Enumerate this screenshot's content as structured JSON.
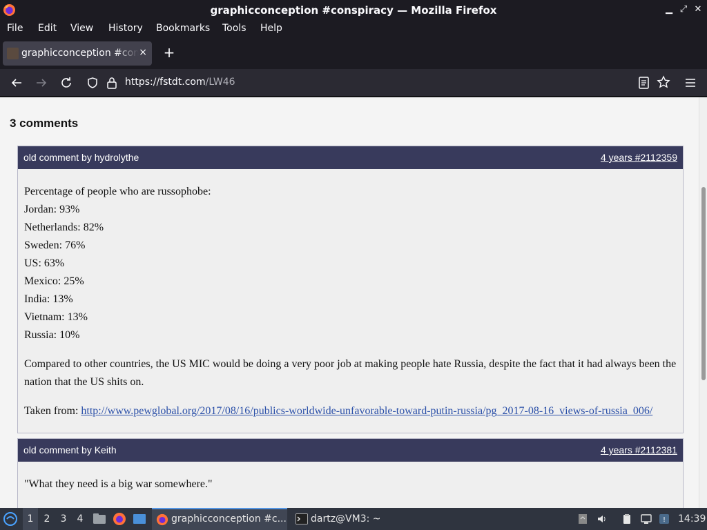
{
  "window": {
    "title": "graphicconception #conspiracy — Mozilla Firefox"
  },
  "menu": {
    "items": [
      "File",
      "Edit",
      "View",
      "History",
      "Bookmarks",
      "Tools",
      "Help"
    ]
  },
  "tabs": [
    {
      "title": "graphicconception #conspiracy",
      "close": "×"
    }
  ],
  "newtab_label": "+",
  "navbar": {
    "url_host": "https://fstdt.com",
    "url_path": "/LW46"
  },
  "page": {
    "comments_count_label": "3 comments",
    "comments": [
      {
        "by": "old comment by hydrolythe",
        "meta": "4 years #2112359",
        "lines": [
          "Percentage of people who are russophobe:",
          "Jordan: 93%",
          "Netherlands: 82%",
          "Sweden: 76%",
          "US: 63%",
          "Mexico: 25%",
          "India: 13%",
          "Vietnam: 13%",
          "Russia: 10%"
        ],
        "paragraph": "Compared to other countries, the US MIC would be doing a very poor job at making people hate Russia, despite the fact that it had always been the nation that the US shits on.",
        "source_prefix": "Taken from: ",
        "source_link": "http://www.pewglobal.org/2017/08/16/publics-worldwide-unfavorable-toward-putin-russia/pg_2017-08-16_views-of-russia_006/"
      },
      {
        "by": "old comment by Keith",
        "meta": "4 years #2112381",
        "lines": [
          "\"What they need is a big war somewhere.\""
        ]
      }
    ]
  },
  "taskbar": {
    "workspaces": [
      "1",
      "2",
      "3",
      "4"
    ],
    "tasks": [
      {
        "label": "graphicconception #c..."
      },
      {
        "label": "dartz@VM3: ~"
      }
    ],
    "clock": "14:39"
  },
  "colors": {
    "comment_header": "#383a5c",
    "link": "#2a4fa8",
    "toolbar": "#2b2a33",
    "taskbar": "#2f343f"
  }
}
